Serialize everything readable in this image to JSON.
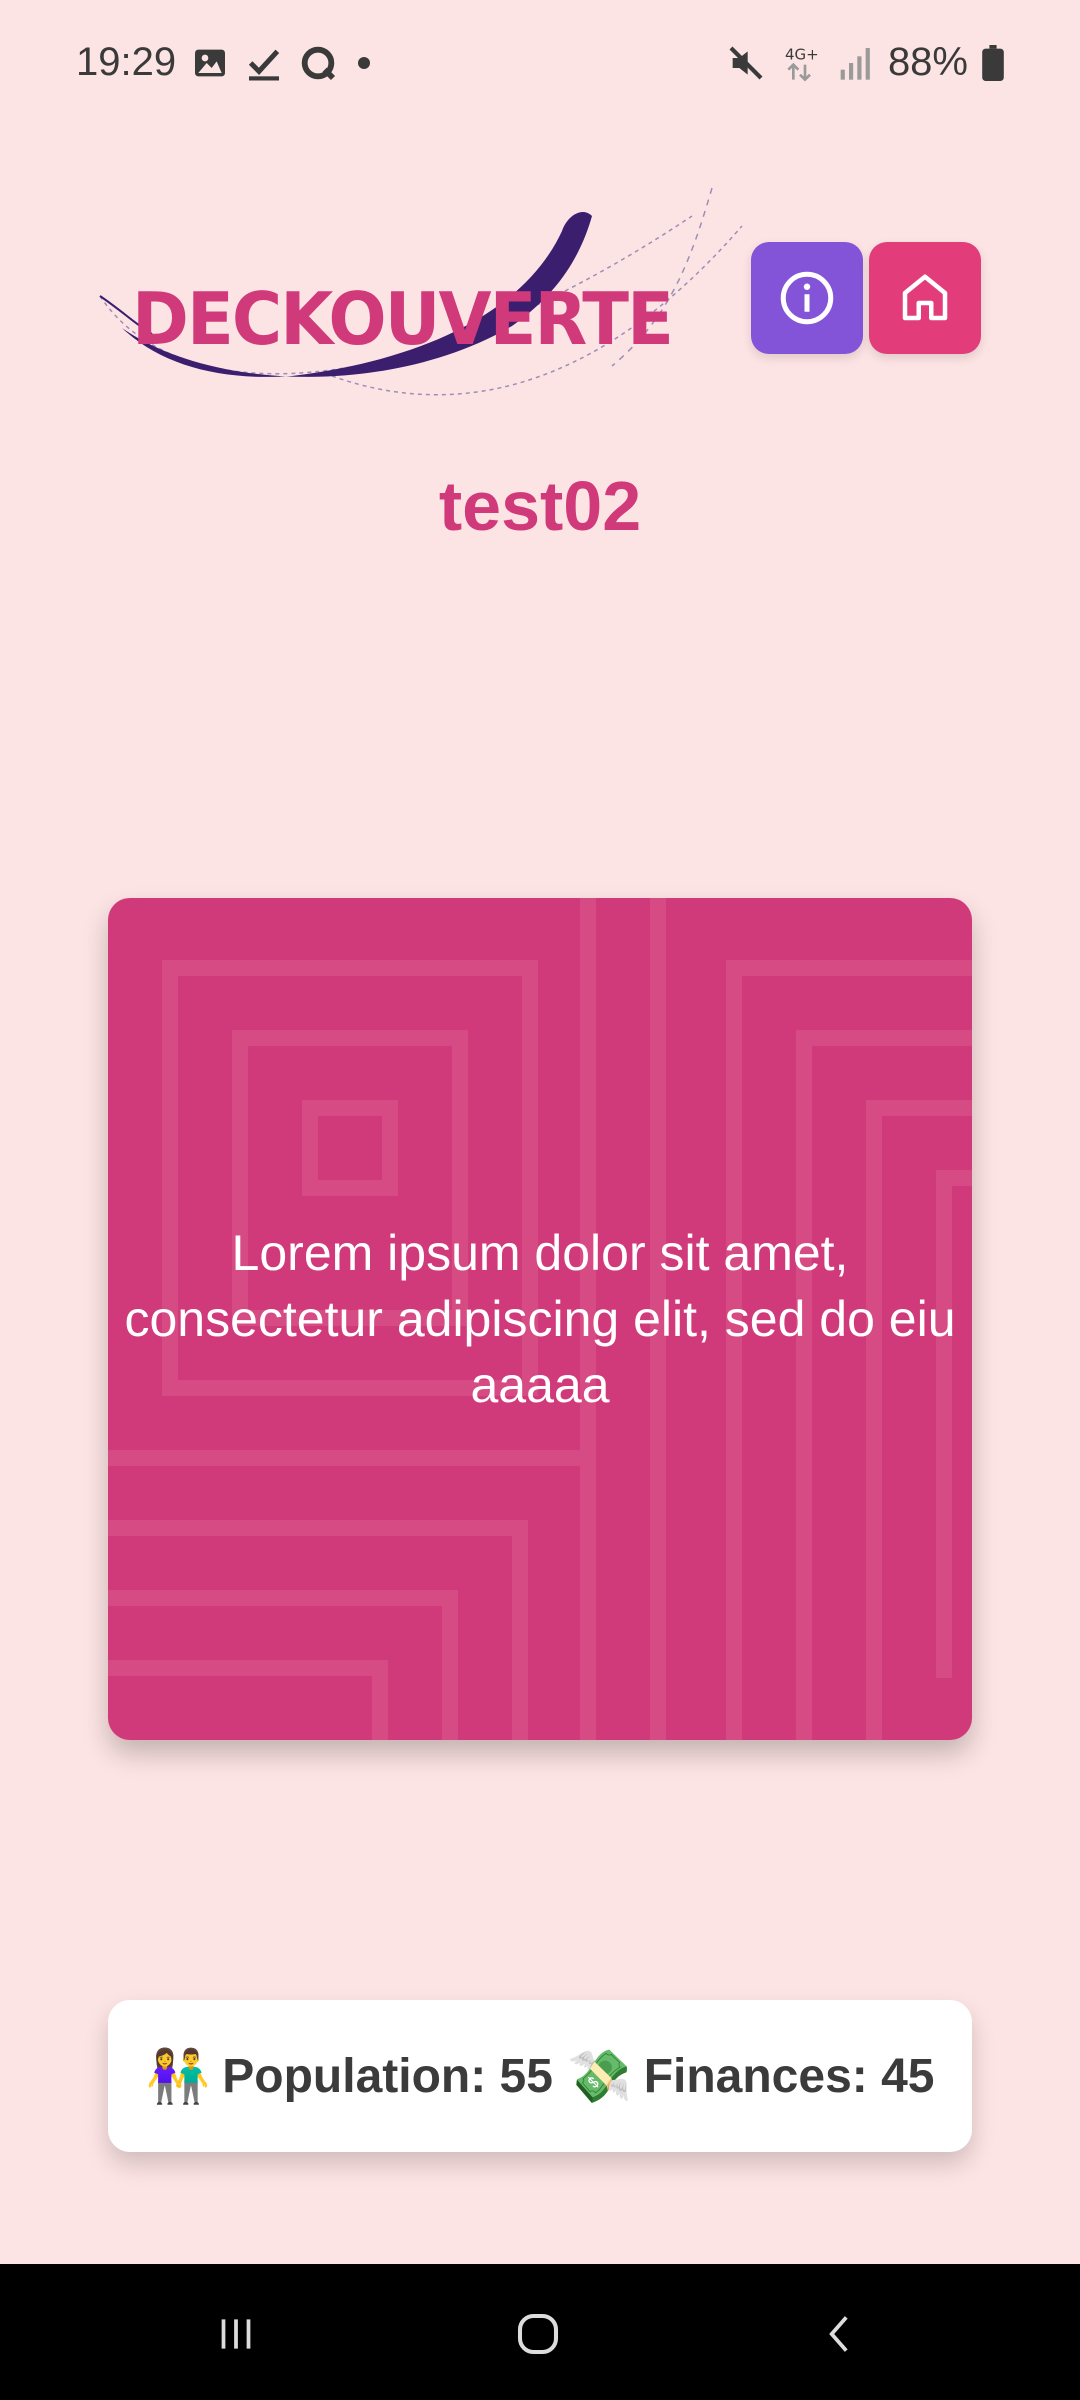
{
  "status_bar": {
    "time": "19:29",
    "battery": "88%",
    "icons": [
      "gallery-icon",
      "check-icon",
      "chat-icon",
      "dot-icon",
      "mute-icon",
      "network-4g-icon",
      "signal-icon",
      "battery-icon"
    ]
  },
  "header": {
    "logo_text": "DECKOUVERTE",
    "info_icon": "info-icon",
    "home_icon": "home-icon",
    "colors": {
      "info": "#8454d8",
      "home": "#e23d7a",
      "logo_text": "#d13a7a",
      "logo_swoosh": "#3b1f6e"
    }
  },
  "page": {
    "title": "test02"
  },
  "card": {
    "text": "Lorem ipsum dolor sit amet, consectetur adipiscing elit, sed do eiu aaaaa",
    "color": "#d13a7a"
  },
  "stats": {
    "population_emoji": "👫",
    "population_text": "Population: 55",
    "finances_emoji": "💸",
    "finances_text": "Finances: 45"
  },
  "nav_bar": {
    "icons": [
      "recent-apps-icon",
      "home-nav-icon",
      "back-icon"
    ]
  }
}
